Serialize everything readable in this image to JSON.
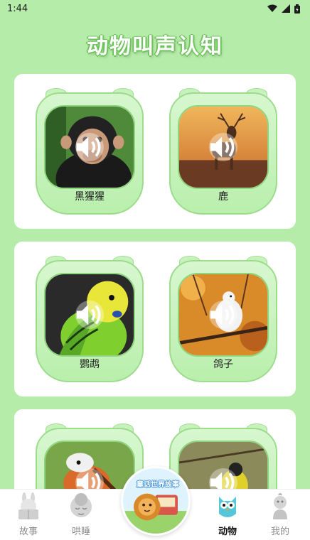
{
  "status_bar": {
    "time": "1:44"
  },
  "page": {
    "title": "动物叫声认知"
  },
  "animals": [
    {
      "name": "黑猩猩"
    },
    {
      "name": "鹿"
    },
    {
      "name": "鹦鹉"
    },
    {
      "name": "鸽子"
    },
    {
      "name": ""
    },
    {
      "name": ""
    }
  ],
  "center_badge": {
    "text": "童话世界故事"
  },
  "nav": {
    "items": [
      {
        "label": "故事"
      },
      {
        "label": "哄睡"
      },
      {
        "label": "动物"
      },
      {
        "label": "我的"
      }
    ],
    "active": "动物"
  },
  "colors": {
    "background": "#b6ecaa",
    "accent_green": "#6fc35c",
    "card": "#ffffff"
  }
}
